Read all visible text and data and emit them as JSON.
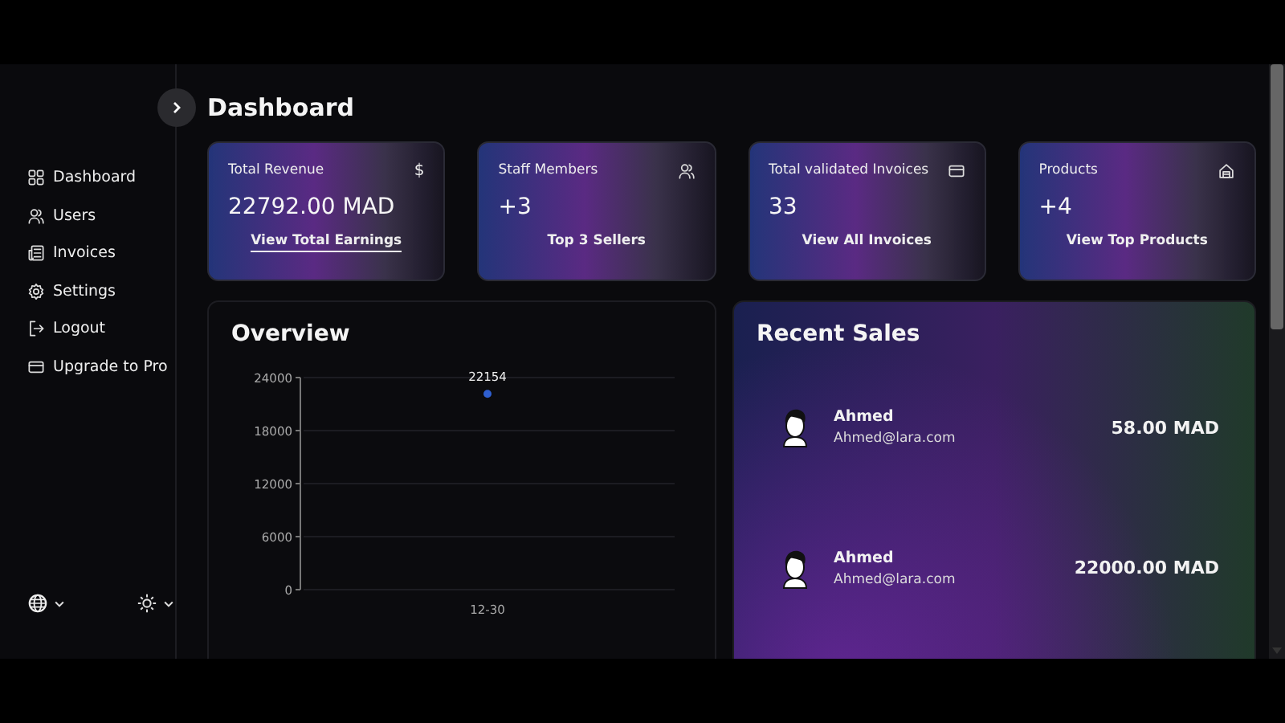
{
  "header": {
    "title": "Dashboard"
  },
  "sidebar": {
    "items": [
      {
        "label": "Dashboard"
      },
      {
        "label": "Users"
      },
      {
        "label": "Invoices"
      },
      {
        "label": "Settings"
      },
      {
        "label": "Logout"
      },
      {
        "label": "Upgrade to Pro"
      }
    ]
  },
  "stat_cards": [
    {
      "title": "Total Revenue",
      "icon": {
        "kind": "text",
        "text": "$"
      },
      "value": "22792.00 MAD",
      "link": "View Total Earnings",
      "hovered": true
    },
    {
      "title": "Staff Members",
      "icon": {
        "kind": "users"
      },
      "value": "+3",
      "link": "Top 3 Sellers",
      "hovered": false
    },
    {
      "title": "Total validated Invoices",
      "icon": {
        "kind": "card"
      },
      "value": "33",
      "link": "View All Invoices",
      "hovered": false
    },
    {
      "title": "Products",
      "icon": {
        "kind": "store"
      },
      "value": "+4",
      "link": "View Top Products",
      "hovered": false
    }
  ],
  "overview": {
    "title": "Overview",
    "chart_data": {
      "type": "scatter",
      "categories": [
        "12-30"
      ],
      "series": [
        {
          "color": "#2f5fd0",
          "values": [
            22154
          ]
        }
      ],
      "ylim": [
        0,
        24000
      ],
      "yticks": [
        0,
        6000,
        12000,
        18000,
        24000
      ],
      "grid": true,
      "data_labels": true
    }
  },
  "recent_sales": {
    "title": "Recent Sales",
    "rows": [
      {
        "name": "Ahmed",
        "email": "Ahmed@lara.com",
        "amount": "58.00 MAD"
      },
      {
        "name": "Ahmed",
        "email": "Ahmed@lara.com",
        "amount": "22000.00 MAD"
      }
    ]
  }
}
